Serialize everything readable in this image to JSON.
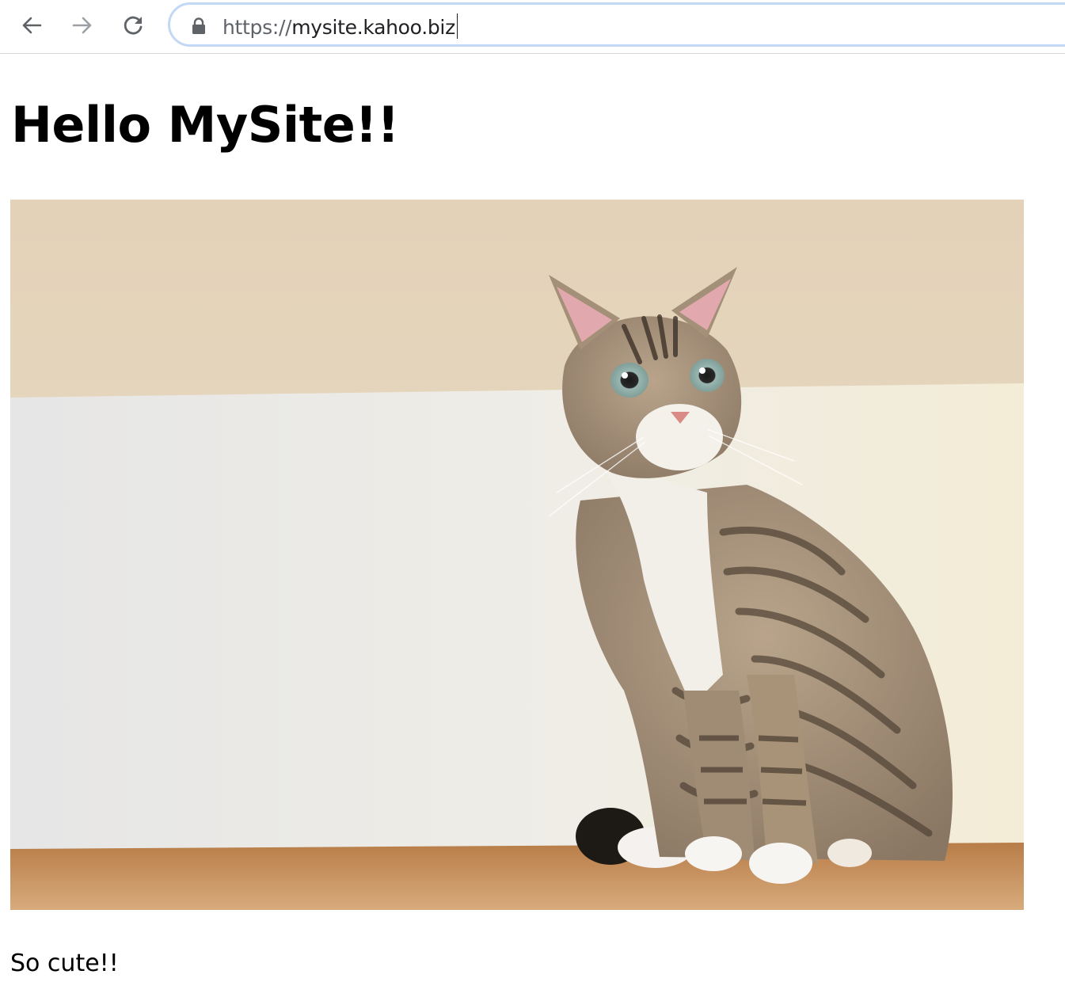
{
  "browser": {
    "url_scheme": "https://",
    "url_host": "mysite.kahoo.biz",
    "icons": {
      "back": "back-arrow-icon",
      "forward": "forward-arrow-icon",
      "reload": "reload-icon",
      "lock": "lock-icon"
    }
  },
  "page": {
    "title": "Hello MySite!!",
    "image": {
      "subject": "tabby cat sitting on a wooden shelf",
      "colors": {
        "wall_upper": "#e3d3ba",
        "wall_lower": "#ecebe6",
        "shelf": "#c08a58"
      }
    },
    "caption": "So cute!!"
  }
}
